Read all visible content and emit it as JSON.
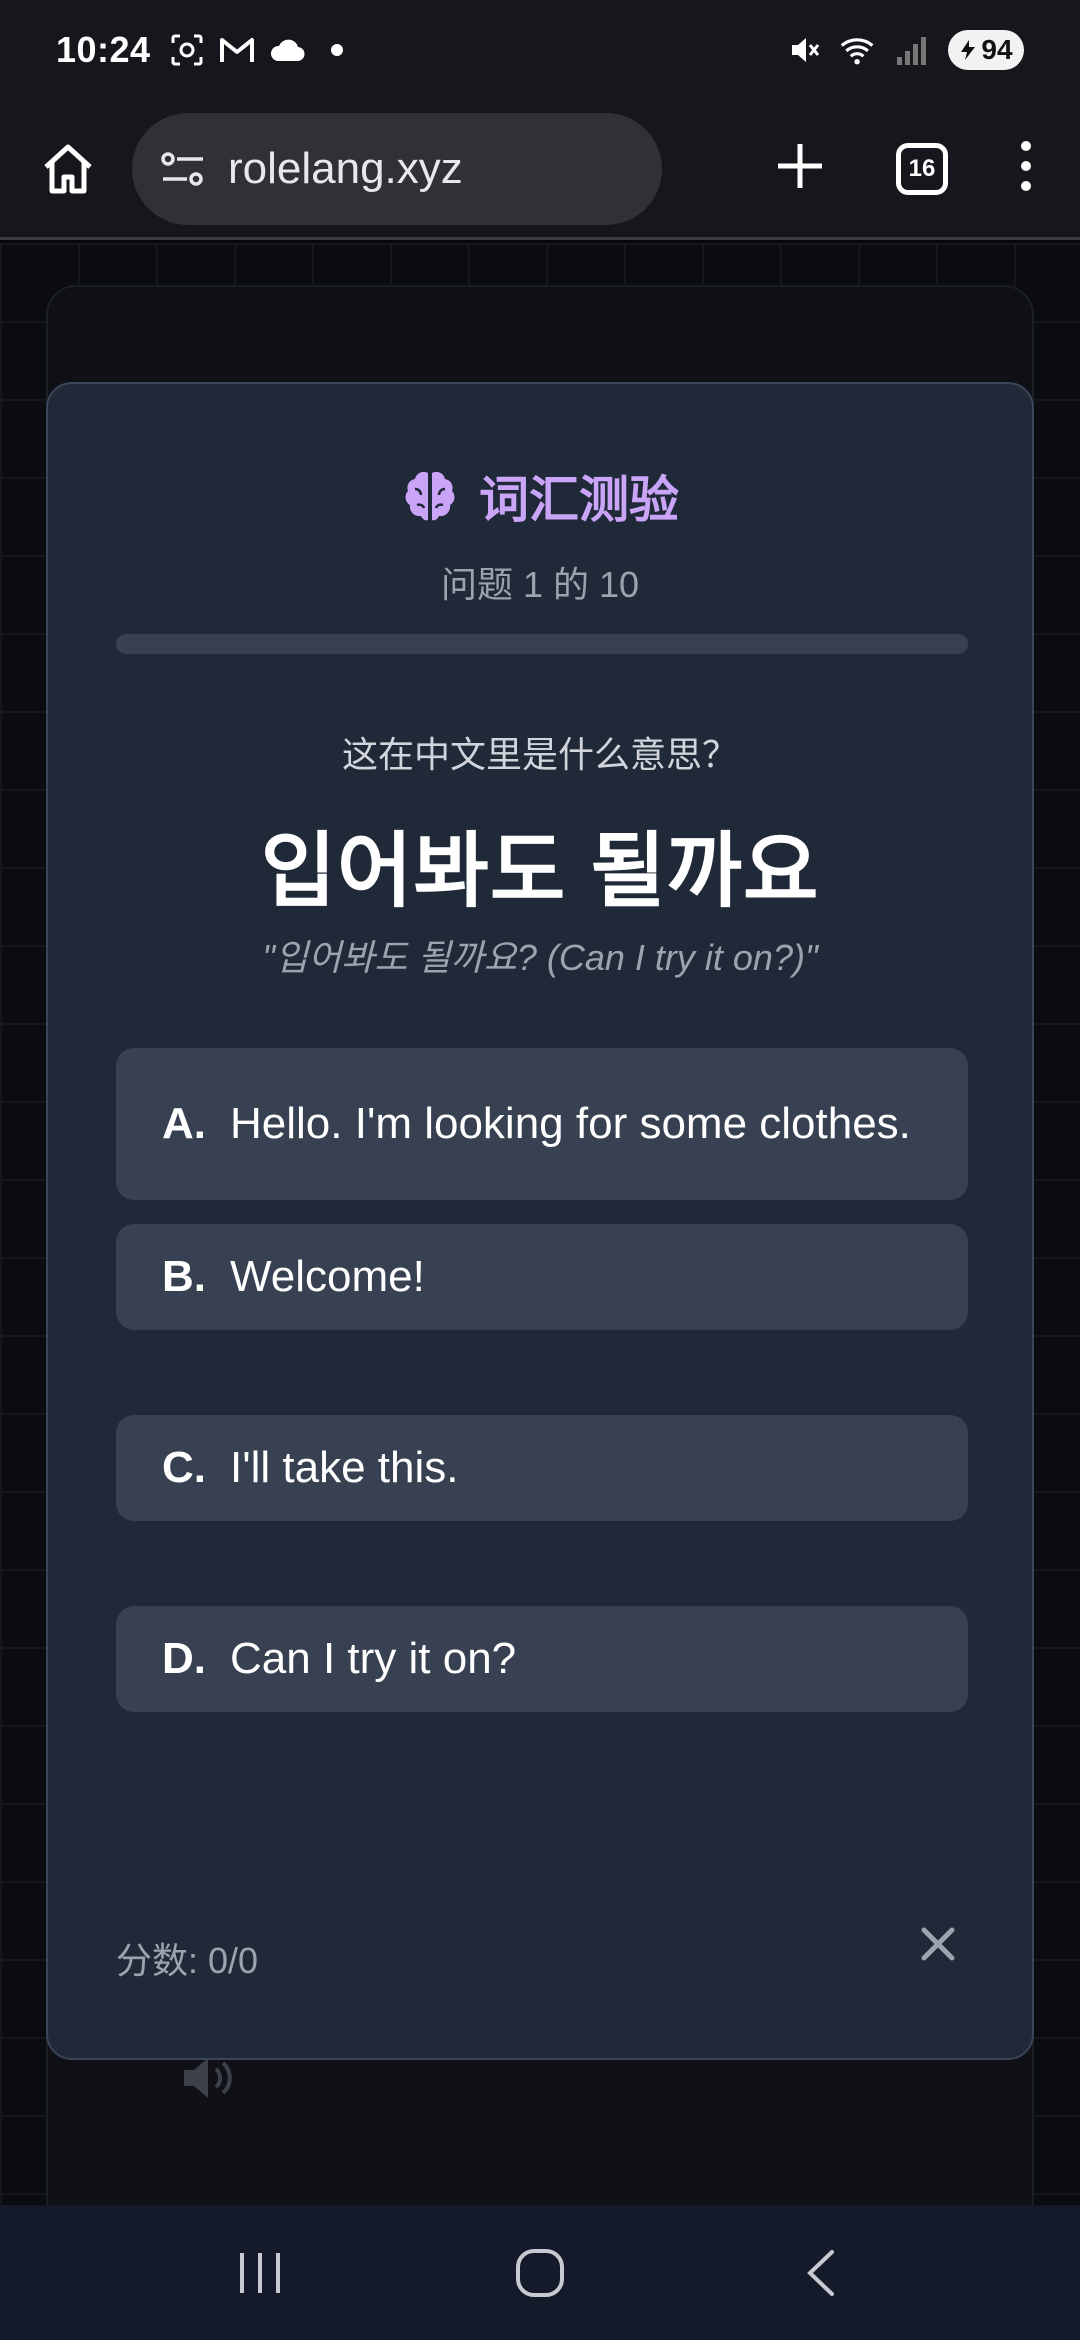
{
  "status_bar": {
    "time": "10:24",
    "battery": "94",
    "icons_left": [
      "screenshot-icon",
      "gmail-icon",
      "cloud-icon",
      "dot-icon"
    ],
    "icons_right": [
      "mute-icon",
      "wifi-icon",
      "signal-icon",
      "battery-icon"
    ]
  },
  "browser": {
    "url": "rolelang.xyz",
    "tab_count": "16"
  },
  "quiz": {
    "title": "词汇测验",
    "progress_text": "问题 1 的 10",
    "progress_fraction": 0.0,
    "prompt": "这在中文里是什么意思？",
    "word": "입어봐도 될까요",
    "example": "\"입어봐도 될까요? (Can I try it on?)\"",
    "options": [
      {
        "letter": "A.",
        "text": "Hello. I'm looking for some clothes."
      },
      {
        "letter": "B.",
        "text": "Welcome!"
      },
      {
        "letter": "C.",
        "text": "I'll take this."
      },
      {
        "letter": "D.",
        "text": "Can I try it on?"
      }
    ],
    "score": "分数: 0/0"
  },
  "colors": {
    "modal_bg": "#1f2937",
    "option_bg": "#374151",
    "accent_purple": "#c9a4f7"
  }
}
